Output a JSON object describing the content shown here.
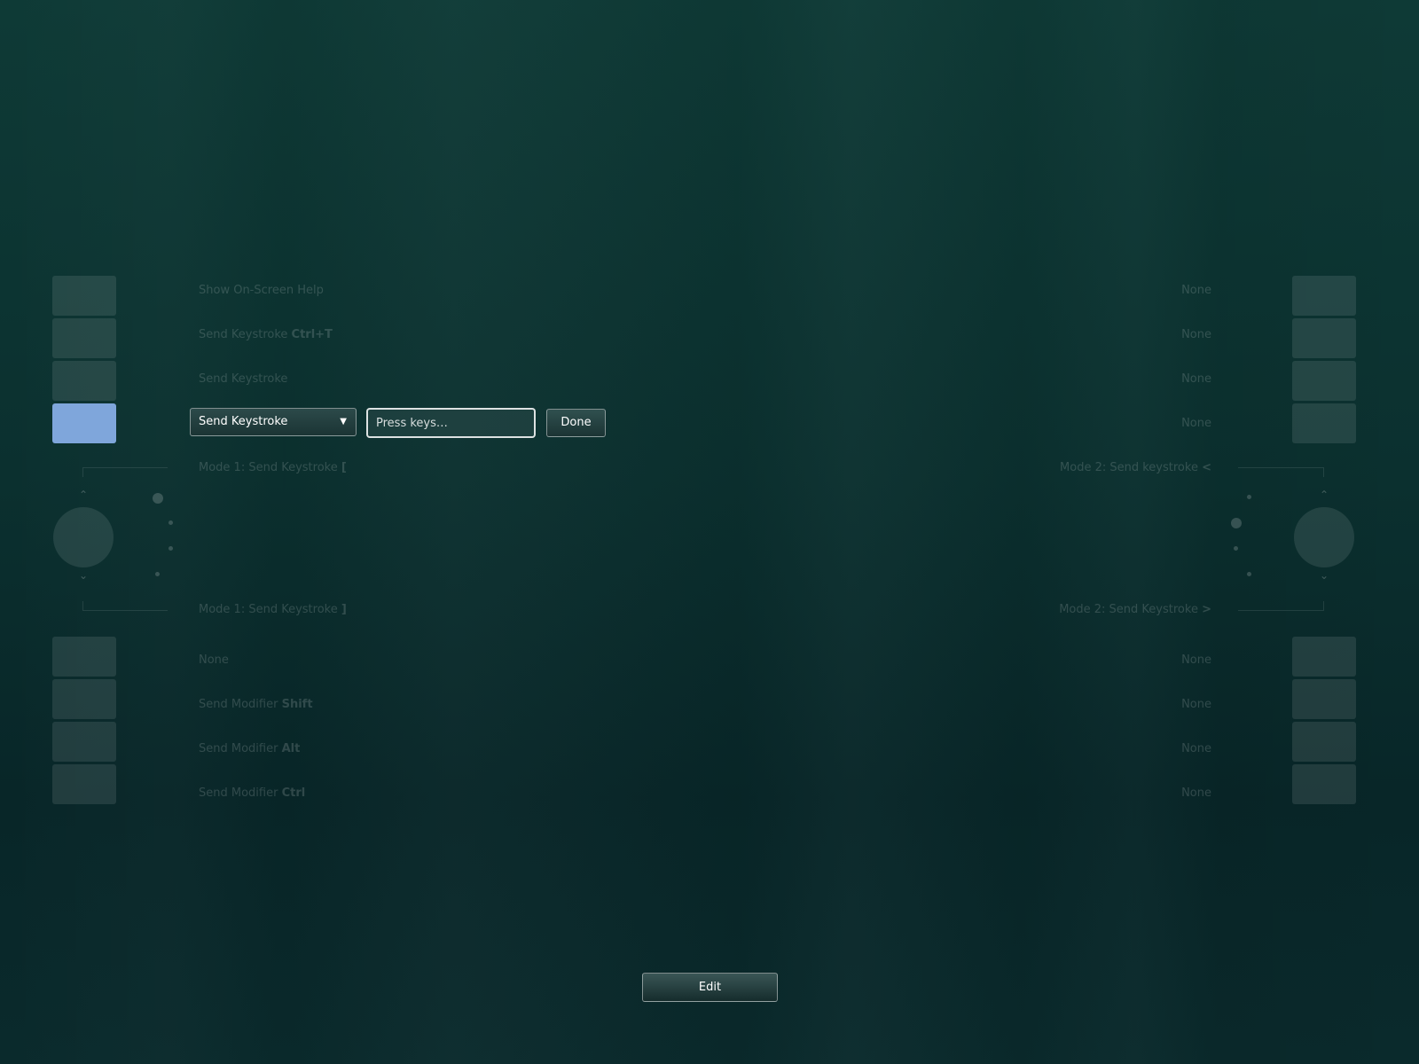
{
  "left_buttons": [
    {
      "label": "Show On-Screen Help",
      "bold": ""
    },
    {
      "label": "Send Keystroke",
      "bold": "Ctrl+T"
    },
    {
      "label": "Send Keystroke",
      "bold": ""
    },
    {
      "label": "",
      "bold": "",
      "editing": true
    },
    {
      "label": "None",
      "bold": ""
    },
    {
      "label": "Send Modifier",
      "bold": "Shift"
    },
    {
      "label": "Send Modifier",
      "bold": "Alt"
    },
    {
      "label": "Send Modifier",
      "bold": "Ctrl"
    }
  ],
  "right_buttons": [
    "None",
    "None",
    "None",
    "None",
    "None",
    "None",
    "None",
    "None"
  ],
  "left_ring": {
    "up_label": "Mode 1: Send Keystroke",
    "up_key": "[",
    "down_label": "Mode 1: Send Keystroke",
    "down_key": "]"
  },
  "right_ring": {
    "up_label": "Mode 2: Send keystroke",
    "up_key": "<",
    "down_label": "Mode 2: Send Keystroke",
    "down_key": ">"
  },
  "editor": {
    "action_selected": "Send Keystroke",
    "keys_placeholder": "Press keys…",
    "done_label": "Done"
  },
  "edit_label": "Edit",
  "colors": {
    "background": "#0b302f",
    "active_button": "#7fa6db"
  },
  "icons": {
    "dropdown": "triangle-down",
    "ring_up": "chevron-up",
    "ring_down": "chevron-down"
  }
}
